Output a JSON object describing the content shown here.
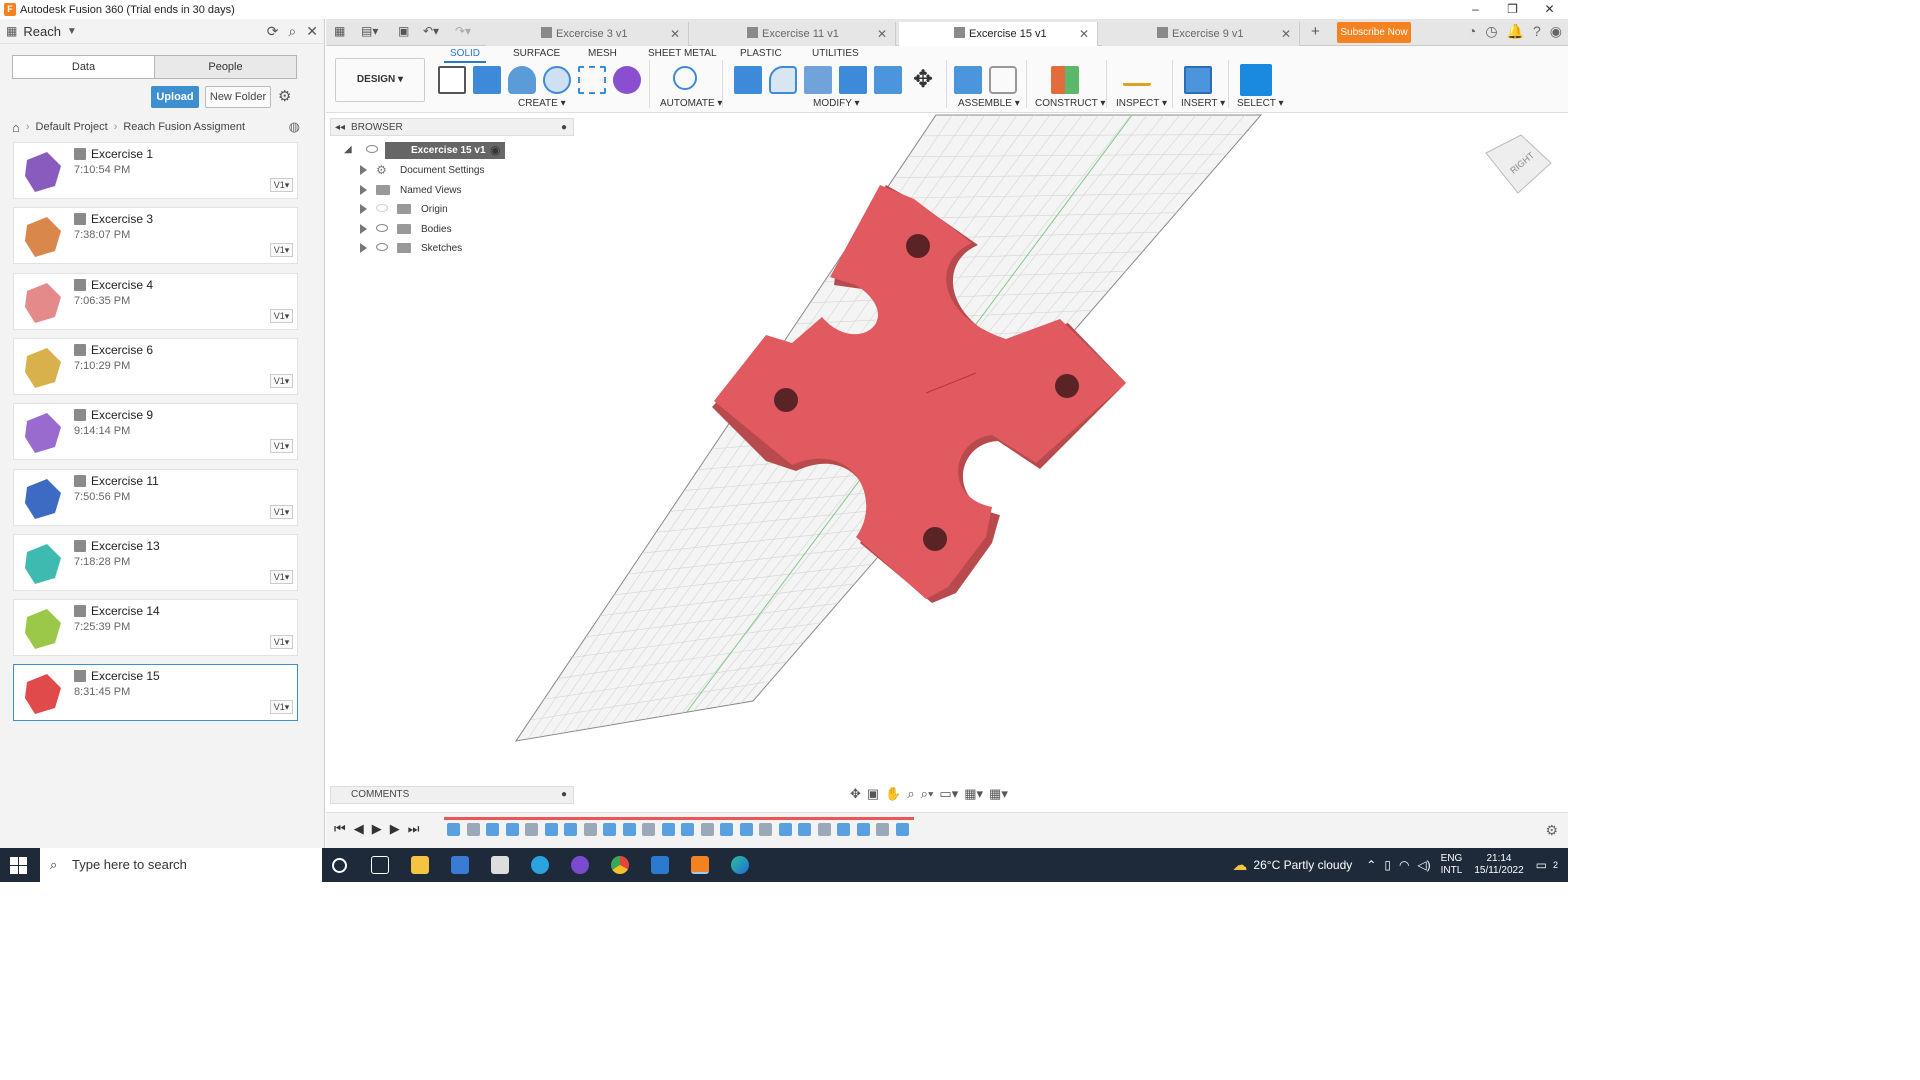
{
  "window": {
    "title": "Autodesk Fusion 360 (Trial ends in 30 days)",
    "min": "–",
    "max": "❐",
    "close": "✕"
  },
  "datapanel": {
    "team": "Reach",
    "tabs": [
      "Data",
      "People"
    ],
    "upload": "Upload",
    "new_folder": "New Folder",
    "breadcrumb": [
      "Default Project",
      "Reach Fusion Assigment"
    ],
    "files": [
      {
        "name": "Excercise 1",
        "time": "7:10:54 PM",
        "ver": "V1",
        "color": "#8a5bbf"
      },
      {
        "name": "Excercise 3",
        "time": "7:38:07 PM",
        "ver": "V1",
        "color": "#d9874a"
      },
      {
        "name": "Excercise 4",
        "time": "7:06:35 PM",
        "ver": "V1",
        "color": "#e58a8a"
      },
      {
        "name": "Excercise 6",
        "time": "7:10:29 PM",
        "ver": "V1",
        "color": "#d8b04c"
      },
      {
        "name": "Excercise 9",
        "time": "9:14:14 PM",
        "ver": "V1",
        "color": "#9a6bcf"
      },
      {
        "name": "Excercise 11",
        "time": "7:50:56 PM",
        "ver": "V1",
        "color": "#3d6bc4"
      },
      {
        "name": "Excercise 13",
        "time": "7:18:28 PM",
        "ver": "V1",
        "color": "#3fbab0"
      },
      {
        "name": "Excercise 14",
        "time": "7:25:39 PM",
        "ver": "V1",
        "color": "#9cc84a"
      },
      {
        "name": "Excercise 15",
        "time": "8:31:45 PM",
        "ver": "V1",
        "color": "#e04a4a"
      }
    ]
  },
  "doctabs": [
    {
      "label": "Excercise 3 v1",
      "active": false
    },
    {
      "label": "Excercise 11 v1",
      "active": false
    },
    {
      "label": "Excercise 15 v1",
      "active": true
    },
    {
      "label": "Excercise 9 v1",
      "active": false
    }
  ],
  "subscribe": "Subscribe Now",
  "ribbon": {
    "tabs": [
      "SOLID",
      "SURFACE",
      "MESH",
      "SHEET METAL",
      "PLASTIC",
      "UTILITIES"
    ],
    "design": "DESIGN ▾",
    "groups": [
      "CREATE ▾",
      "AUTOMATE ▾",
      "MODIFY ▾",
      "ASSEMBLE ▾",
      "CONSTRUCT ▾",
      "INSPECT ▾",
      "INSERT ▾",
      "SELECT ▾"
    ]
  },
  "browser": {
    "title": "BROWSER",
    "root": "Excercise 15 v1",
    "items": [
      "Document Settings",
      "Named Views",
      "Origin",
      "Bodies",
      "Sketches"
    ]
  },
  "comments": "COMMENTS",
  "viewcube": "RIGHT",
  "model_color": "#e05a60",
  "taskbar": {
    "search": "Type here to search",
    "weather": "26°C  Partly cloudy",
    "lang1": "ENG",
    "lang2": "INTL",
    "time": "21:14",
    "date": "15/11/2022",
    "notif": "2"
  }
}
